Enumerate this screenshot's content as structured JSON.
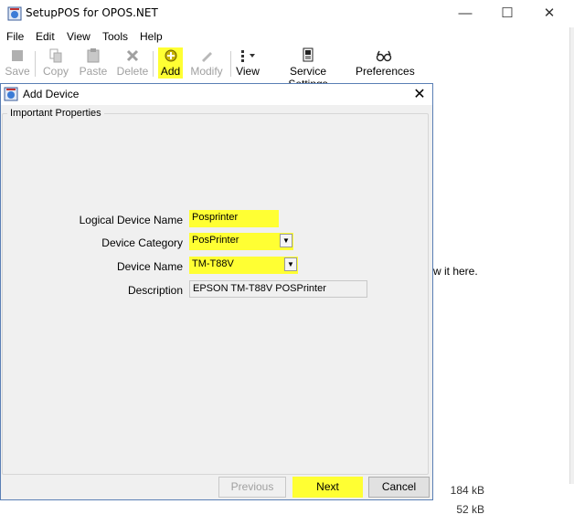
{
  "window": {
    "title": "SetupPOS for OPOS.NET",
    "menu": [
      "File",
      "Edit",
      "View",
      "Tools",
      "Help"
    ]
  },
  "toolbar": {
    "save": "Save",
    "copy": "Copy",
    "paste": "Paste",
    "delete": "Delete",
    "add": "Add",
    "modify": "Modify",
    "view": "View",
    "service_settings": "Service Settings",
    "preferences": "Preferences"
  },
  "background": {
    "hint_text": "w it here.",
    "sizes": [
      "184 kB",
      "52 kB"
    ]
  },
  "dialog": {
    "title": "Add Device",
    "group_label": "Important Properties",
    "fields": {
      "logical_device_name_label": "Logical Device Name",
      "logical_device_name_value": "Posprinter",
      "device_category_label": "Device Category",
      "device_category_value": "PosPrinter",
      "device_name_label": "Device Name",
      "device_name_value": "TM-T88V",
      "description_label": "Description",
      "description_value": "EPSON TM-T88V POSPrinter"
    },
    "buttons": {
      "previous": "Previous",
      "next": "Next",
      "cancel": "Cancel"
    }
  },
  "colors": {
    "highlight": "#ffff33",
    "dialog_bg": "#f0f0f0",
    "dialog_border": "#5a7fb5"
  }
}
